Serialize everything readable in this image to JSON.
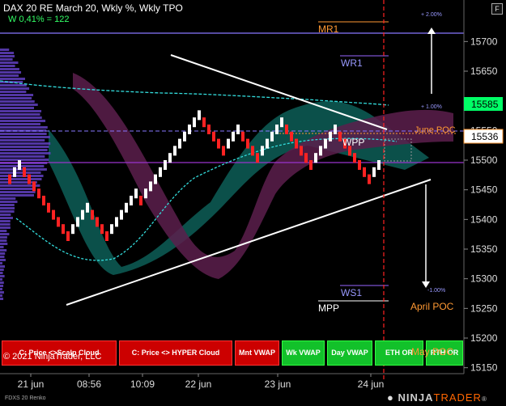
{
  "header": {
    "title": "DAX 20 RE March 20, Wkly %, Wkly TPO",
    "subtitle": "W 0,41% = 122"
  },
  "chart_data": {
    "type": "candlestick-renko",
    "ylim": [
      15140,
      15770
    ],
    "y_ticks": [
      15150,
      15200,
      15250,
      15300,
      15350,
      15400,
      15450,
      15500,
      15550,
      15600,
      15650,
      15700
    ],
    "x_ticks": [
      "21 jun",
      "08:56",
      "10:09",
      "22 jun",
      "23 jun",
      "24 jun"
    ],
    "price_badges": [
      {
        "label": "15585",
        "value": 15585,
        "color": "#00ff66"
      },
      {
        "label": "15536",
        "value": 15536,
        "color": "#ffffff"
      }
    ],
    "levels": [
      {
        "name": "MR1",
        "value": 15720,
        "color": "#ff9933"
      },
      {
        "name": "WR1",
        "value": 15668,
        "color": "#9966ff"
      },
      {
        "name": "WPP",
        "value": 15516,
        "color": "#ffffff"
      },
      {
        "name": "WS1",
        "value": 15283,
        "color": "#9966ff"
      },
      {
        "name": "MPP",
        "value": 15257,
        "color": "#ffffff"
      }
    ],
    "annotations": [
      {
        "text": "+ 2.00%",
        "color": "#9999ff"
      },
      {
        "text": "+ 1.00%",
        "color": "#9999ff"
      },
      {
        "text": "-1.00%",
        "color": "#9999ff"
      },
      {
        "text": "June POC",
        "color": "#ff9933"
      },
      {
        "text": "April POC",
        "color": "#ff9933"
      },
      {
        "text": "May POC",
        "color": "#ff9933"
      }
    ],
    "renko_bricks": [
      {
        "x": 10,
        "dir": "down"
      },
      {
        "x": 16,
        "dir": "up"
      },
      {
        "x": 22,
        "dir": "up"
      },
      {
        "x": 28,
        "dir": "down"
      },
      {
        "x": 34,
        "dir": "down"
      },
      {
        "x": 40,
        "dir": "down"
      },
      {
        "x": 46,
        "dir": "down"
      },
      {
        "x": 52,
        "dir": "down"
      },
      {
        "x": 58,
        "dir": "down"
      },
      {
        "x": 64,
        "dir": "down"
      },
      {
        "x": 70,
        "dir": "down"
      },
      {
        "x": 76,
        "dir": "down"
      },
      {
        "x": 82,
        "dir": "down"
      },
      {
        "x": 88,
        "dir": "up"
      },
      {
        "x": 94,
        "dir": "up"
      },
      {
        "x": 100,
        "dir": "up"
      },
      {
        "x": 106,
        "dir": "up"
      },
      {
        "x": 112,
        "dir": "down"
      },
      {
        "x": 118,
        "dir": "down"
      },
      {
        "x": 124,
        "dir": "down"
      },
      {
        "x": 130,
        "dir": "down"
      },
      {
        "x": 136,
        "dir": "up"
      },
      {
        "x": 142,
        "dir": "up"
      },
      {
        "x": 148,
        "dir": "up"
      },
      {
        "x": 154,
        "dir": "up"
      },
      {
        "x": 160,
        "dir": "up"
      },
      {
        "x": 166,
        "dir": "up"
      },
      {
        "x": 172,
        "dir": "down"
      },
      {
        "x": 178,
        "dir": "up"
      },
      {
        "x": 184,
        "dir": "up"
      },
      {
        "x": 190,
        "dir": "up"
      },
      {
        "x": 196,
        "dir": "up"
      },
      {
        "x": 202,
        "dir": "up"
      },
      {
        "x": 208,
        "dir": "up"
      },
      {
        "x": 214,
        "dir": "up"
      },
      {
        "x": 220,
        "dir": "up"
      },
      {
        "x": 226,
        "dir": "up"
      },
      {
        "x": 232,
        "dir": "up"
      },
      {
        "x": 238,
        "dir": "up"
      },
      {
        "x": 244,
        "dir": "up"
      },
      {
        "x": 250,
        "dir": "down"
      },
      {
        "x": 256,
        "dir": "down"
      },
      {
        "x": 262,
        "dir": "down"
      },
      {
        "x": 268,
        "dir": "down"
      },
      {
        "x": 274,
        "dir": "down"
      },
      {
        "x": 280,
        "dir": "up"
      },
      {
        "x": 286,
        "dir": "up"
      },
      {
        "x": 292,
        "dir": "up"
      },
      {
        "x": 298,
        "dir": "down"
      },
      {
        "x": 304,
        "dir": "down"
      },
      {
        "x": 310,
        "dir": "down"
      },
      {
        "x": 316,
        "dir": "down"
      },
      {
        "x": 322,
        "dir": "up"
      },
      {
        "x": 328,
        "dir": "up"
      },
      {
        "x": 334,
        "dir": "up"
      },
      {
        "x": 340,
        "dir": "up"
      },
      {
        "x": 346,
        "dir": "up"
      },
      {
        "x": 352,
        "dir": "down"
      },
      {
        "x": 358,
        "dir": "down"
      },
      {
        "x": 364,
        "dir": "down"
      },
      {
        "x": 370,
        "dir": "down"
      },
      {
        "x": 376,
        "dir": "down"
      },
      {
        "x": 382,
        "dir": "down"
      },
      {
        "x": 388,
        "dir": "up"
      },
      {
        "x": 394,
        "dir": "up"
      },
      {
        "x": 400,
        "dir": "up"
      },
      {
        "x": 406,
        "dir": "up"
      },
      {
        "x": 412,
        "dir": "up"
      },
      {
        "x": 418,
        "dir": "down"
      },
      {
        "x": 424,
        "dir": "down"
      },
      {
        "x": 430,
        "dir": "down"
      },
      {
        "x": 436,
        "dir": "down"
      },
      {
        "x": 442,
        "dir": "down"
      },
      {
        "x": 448,
        "dir": "down"
      },
      {
        "x": 454,
        "dir": "down"
      },
      {
        "x": 460,
        "dir": "up"
      },
      {
        "x": 466,
        "dir": "up"
      }
    ]
  },
  "buttons": [
    {
      "label": "C: Price <>Scalp Cloud",
      "color": "red"
    },
    {
      "label": "C: Price <> HYPER Cloud",
      "color": "red"
    },
    {
      "label": "Mnt VWAP",
      "color": "red"
    },
    {
      "label": "Wk VWAP",
      "color": "green"
    },
    {
      "label": "Day VWAP",
      "color": "green"
    },
    {
      "label": "ETH OR",
      "color": "green"
    },
    {
      "label": "RTH OR",
      "color": "green"
    }
  ],
  "footer": {
    "copyright": "© 2021 NinjaTrader, LLC",
    "instrument": "FDXS 20 Renko",
    "logo_left": "NINJA",
    "logo_right": "TRADER",
    "logo_mark": "®"
  },
  "colors": {
    "up_brick": "#ffffff",
    "down_brick": "#ff2222",
    "cloud_teal": "#0f6b63",
    "cloud_magenta": "#5c1f4c",
    "vwap_cyan": "#33dddd",
    "volume_profile": "#6040c0"
  },
  "window_button_icon": "window-menu-icon"
}
